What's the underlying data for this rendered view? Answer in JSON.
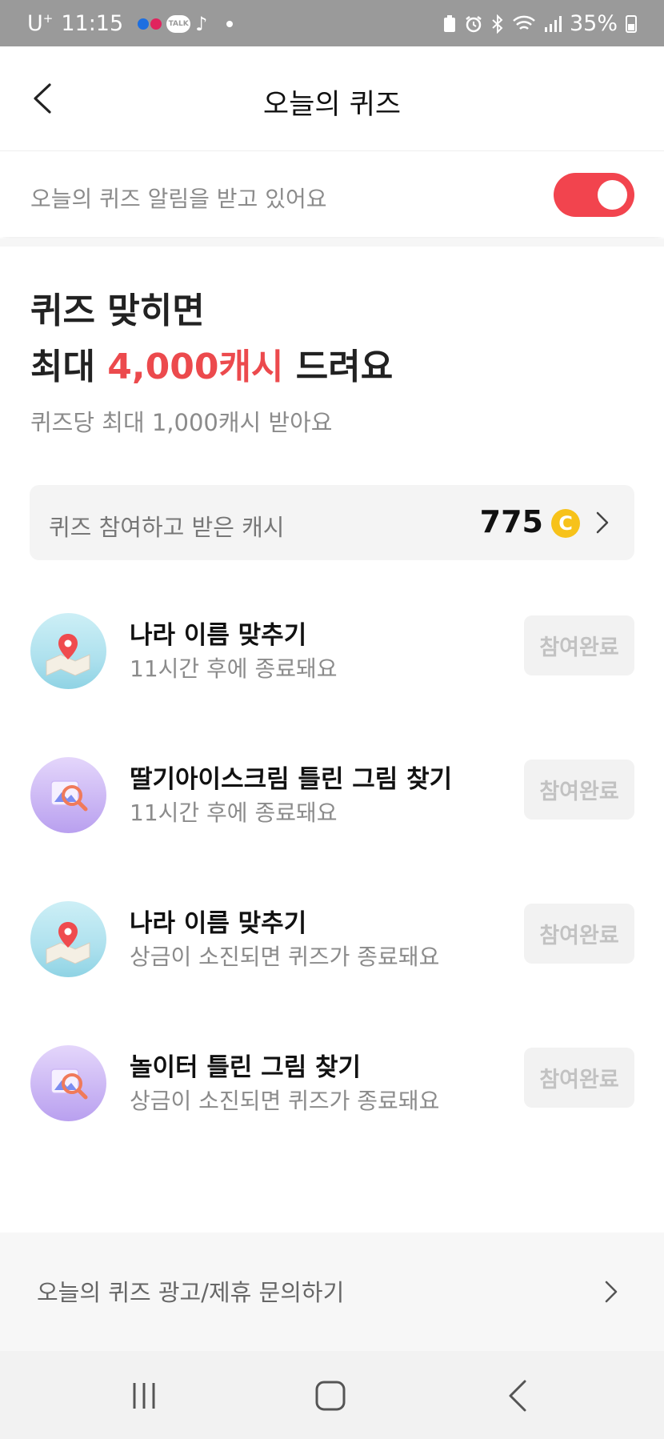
{
  "status_bar": {
    "carrier": "U",
    "carrier_sup": "+",
    "time": "11:15",
    "talk_badge": "TALK",
    "tiktok_glyph": "♪",
    "icons": [
      "battery-saver-icon",
      "alarm-icon",
      "bluetooth-icon",
      "wifi-icon",
      "signal-icon"
    ],
    "battery_percent": "35%"
  },
  "header": {
    "title": "오늘의 퀴즈"
  },
  "notification": {
    "text": "오늘의 퀴즈 알림을 받고 있어요",
    "toggle_on": true
  },
  "hero": {
    "line1": "퀴즈 맞히면",
    "line2_prefix": "최대 ",
    "line2_accent": "4,000캐시",
    "line2_suffix": " 드려요",
    "subtitle": "퀴즈당 최대 1,000캐시 받아요"
  },
  "earned": {
    "label": "퀴즈 참여하고 받은 캐시",
    "value": "775",
    "coin_glyph": "C"
  },
  "quizzes": [
    {
      "title": "나라 이름 맞추기",
      "subtitle": "11시간 후에 종료돼요",
      "button": "참여완료",
      "icon": "map-pin-icon"
    },
    {
      "title": "딸기아이스크림 틀린 그림 찾기",
      "subtitle": "11시간 후에 종료돼요",
      "button": "참여완료",
      "icon": "magnifier-picture-icon"
    },
    {
      "title": "나라 이름 맞추기",
      "subtitle": "상금이 소진되면 퀴즈가 종료돼요",
      "button": "참여완료",
      "icon": "map-pin-icon"
    },
    {
      "title": "놀이터 틀린 그림 찾기",
      "subtitle": "상금이 소진되면 퀴즈가 종료돼요",
      "button": "참여완료",
      "icon": "magnifier-picture-icon"
    }
  ],
  "inquiry": {
    "text": "오늘의 퀴즈 광고/제휴 문의하기"
  },
  "colors": {
    "accent": "#ec4a4d",
    "toggle": "#f2444e",
    "coin": "#f7c21a"
  }
}
